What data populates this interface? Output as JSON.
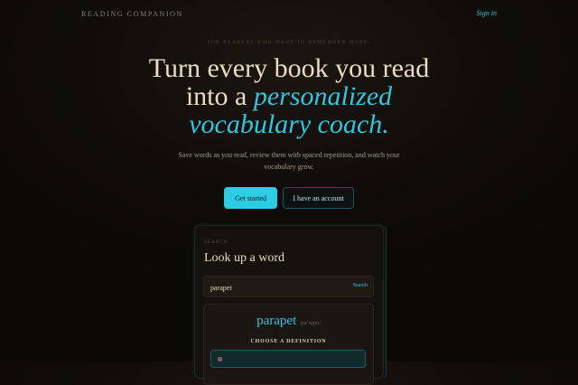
{
  "header": {
    "brand": "READING COMPANION",
    "sign_in": "Sign in"
  },
  "hero": {
    "tagline": "FOR READERS WHO WANT TO REMEMBER MORE.",
    "headline_line1": "Turn every book you read",
    "headline_line2_prefix": "into a ",
    "headline_accent_line2": "personalized",
    "headline_accent_line3": "vocabulary coach.",
    "subtitle": "Save words as you read, review them with spaced repetition, and watch your vocabulary grow.",
    "primary_cta": "Get started",
    "secondary_cta": "I have an account"
  },
  "card": {
    "label": "SEARCH",
    "title": "Look up a word",
    "search_value": "parapet",
    "search_button": "Search",
    "result_word": "parapet",
    "result_pronunciation": "/pəˈrapɪt/",
    "choose_label": "CHOOSE A DEFINITION"
  },
  "colors": {
    "accent": "#2fc6e0",
    "background": "#0f0c09",
    "text": "#ecdcc2"
  }
}
